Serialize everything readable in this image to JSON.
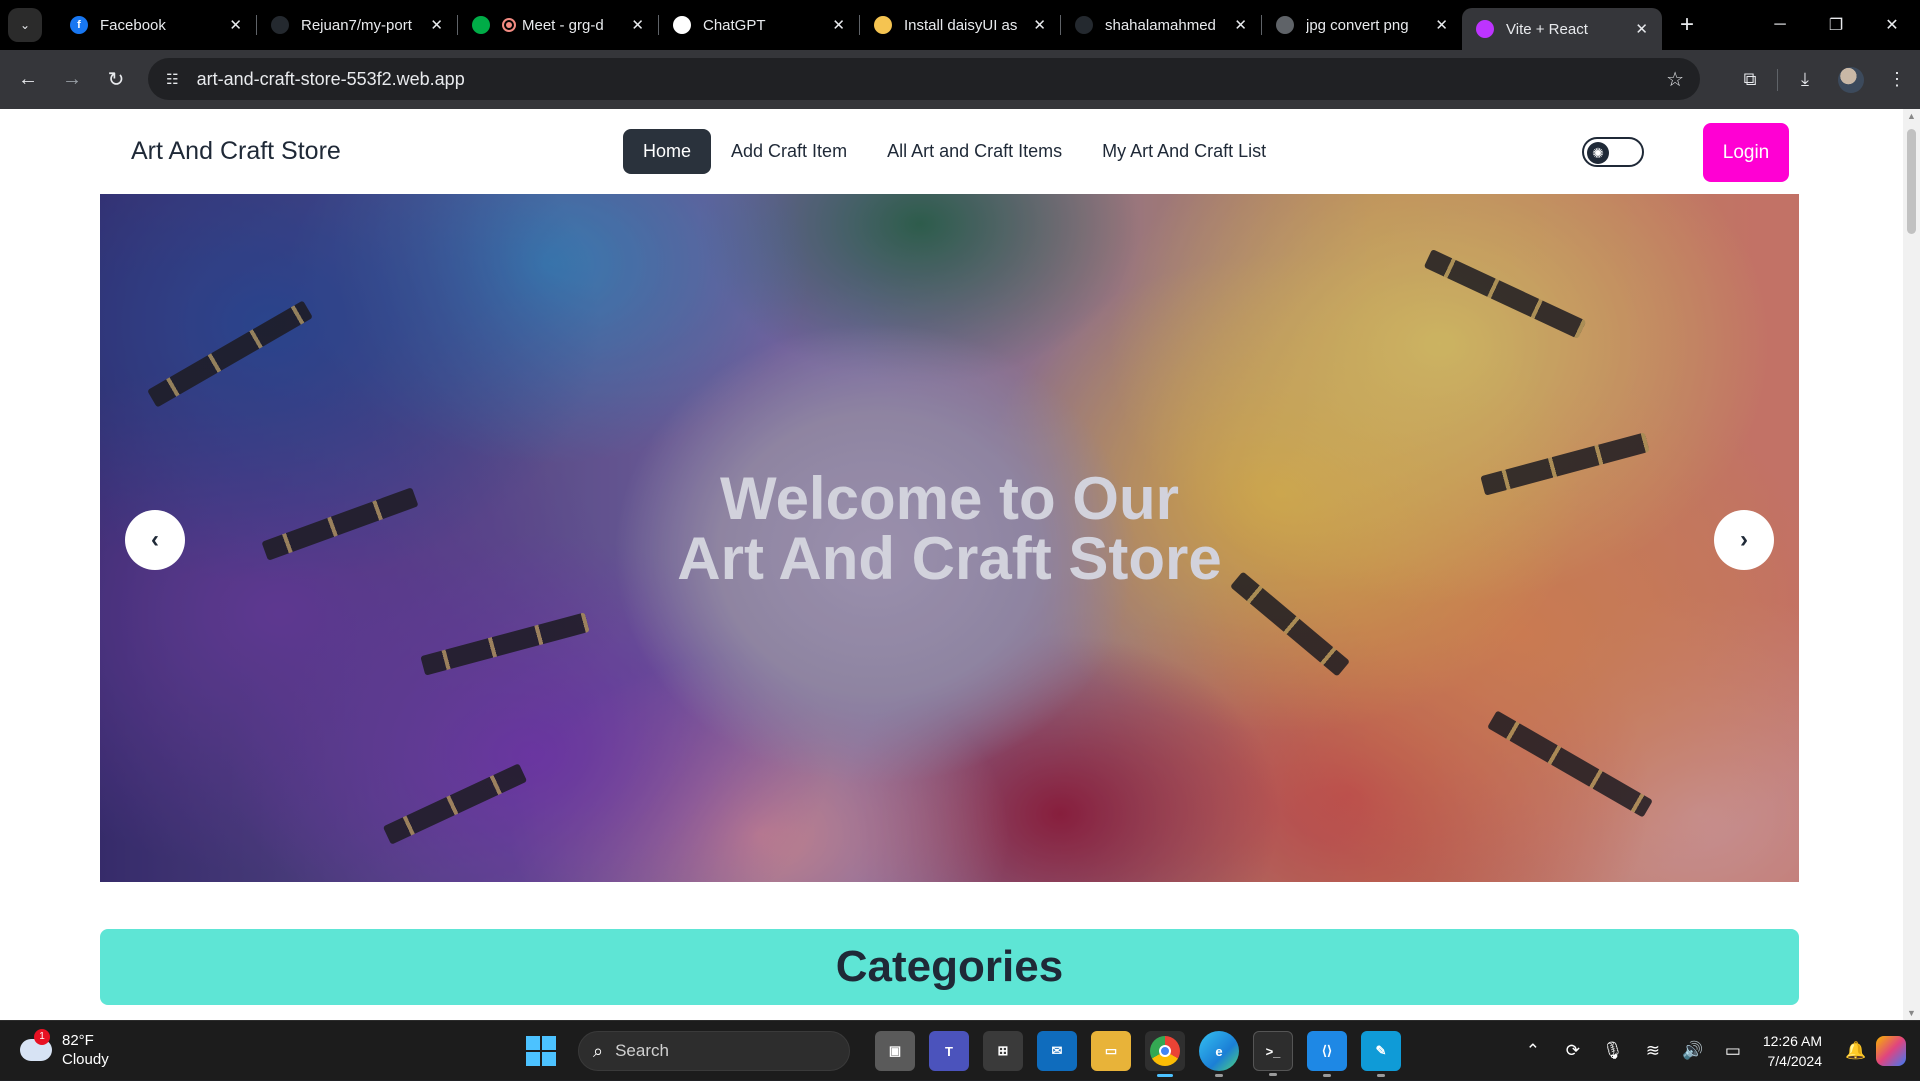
{
  "browser": {
    "tabs": [
      {
        "title": "Facebook",
        "favicon": "facebook-icon",
        "color": "#1877f2",
        "glyph": "f"
      },
      {
        "title": "Rejuan7/my-port",
        "favicon": "github-icon",
        "color": "#24292f",
        "glyph": ""
      },
      {
        "title": "Meet - grg-d",
        "favicon": "meet-icon",
        "color": "#00ac47",
        "glyph": ""
      },
      {
        "title": "ChatGPT",
        "favicon": "chatgpt-icon",
        "color": "#ffffff",
        "glyph": ""
      },
      {
        "title": "Install daisyUI as",
        "favicon": "daisyui-icon",
        "color": "#f5c451",
        "glyph": ""
      },
      {
        "title": "shahalamahmed",
        "favicon": "github-icon",
        "color": "#24292f",
        "glyph": ""
      },
      {
        "title": "jpg convert png",
        "favicon": "globe-icon",
        "color": "#5f6368",
        "glyph": ""
      },
      {
        "title": "Vite + React",
        "favicon": "vite-icon",
        "color": "#bd34fe",
        "glyph": ""
      }
    ],
    "active_tab_index": 7,
    "url": "art-and-craft-store-553f2.web.app"
  },
  "site": {
    "brand": "Art And Craft Store",
    "nav": [
      {
        "label": "Home",
        "active": true
      },
      {
        "label": "Add Craft Item",
        "active": false
      },
      {
        "label": "All Art and Craft Items",
        "active": false
      },
      {
        "label": "My Art And Craft List",
        "active": false
      }
    ],
    "login_label": "Login",
    "accent_color": "#ff00d3",
    "theme_toggle_icon": "sun-icon"
  },
  "hero": {
    "title_line1": "Welcome to Our",
    "title_line2": "Art And Craft Store",
    "prev_label": "‹",
    "next_label": "›"
  },
  "categories": {
    "heading": "Categories",
    "bg_color": "#5ee5d5"
  },
  "taskbar": {
    "weather": {
      "temp": "82°F",
      "condition": "Cloudy",
      "badge": "1"
    },
    "search_placeholder": "Search",
    "time": "12:26 AM",
    "date": "7/4/2024"
  }
}
